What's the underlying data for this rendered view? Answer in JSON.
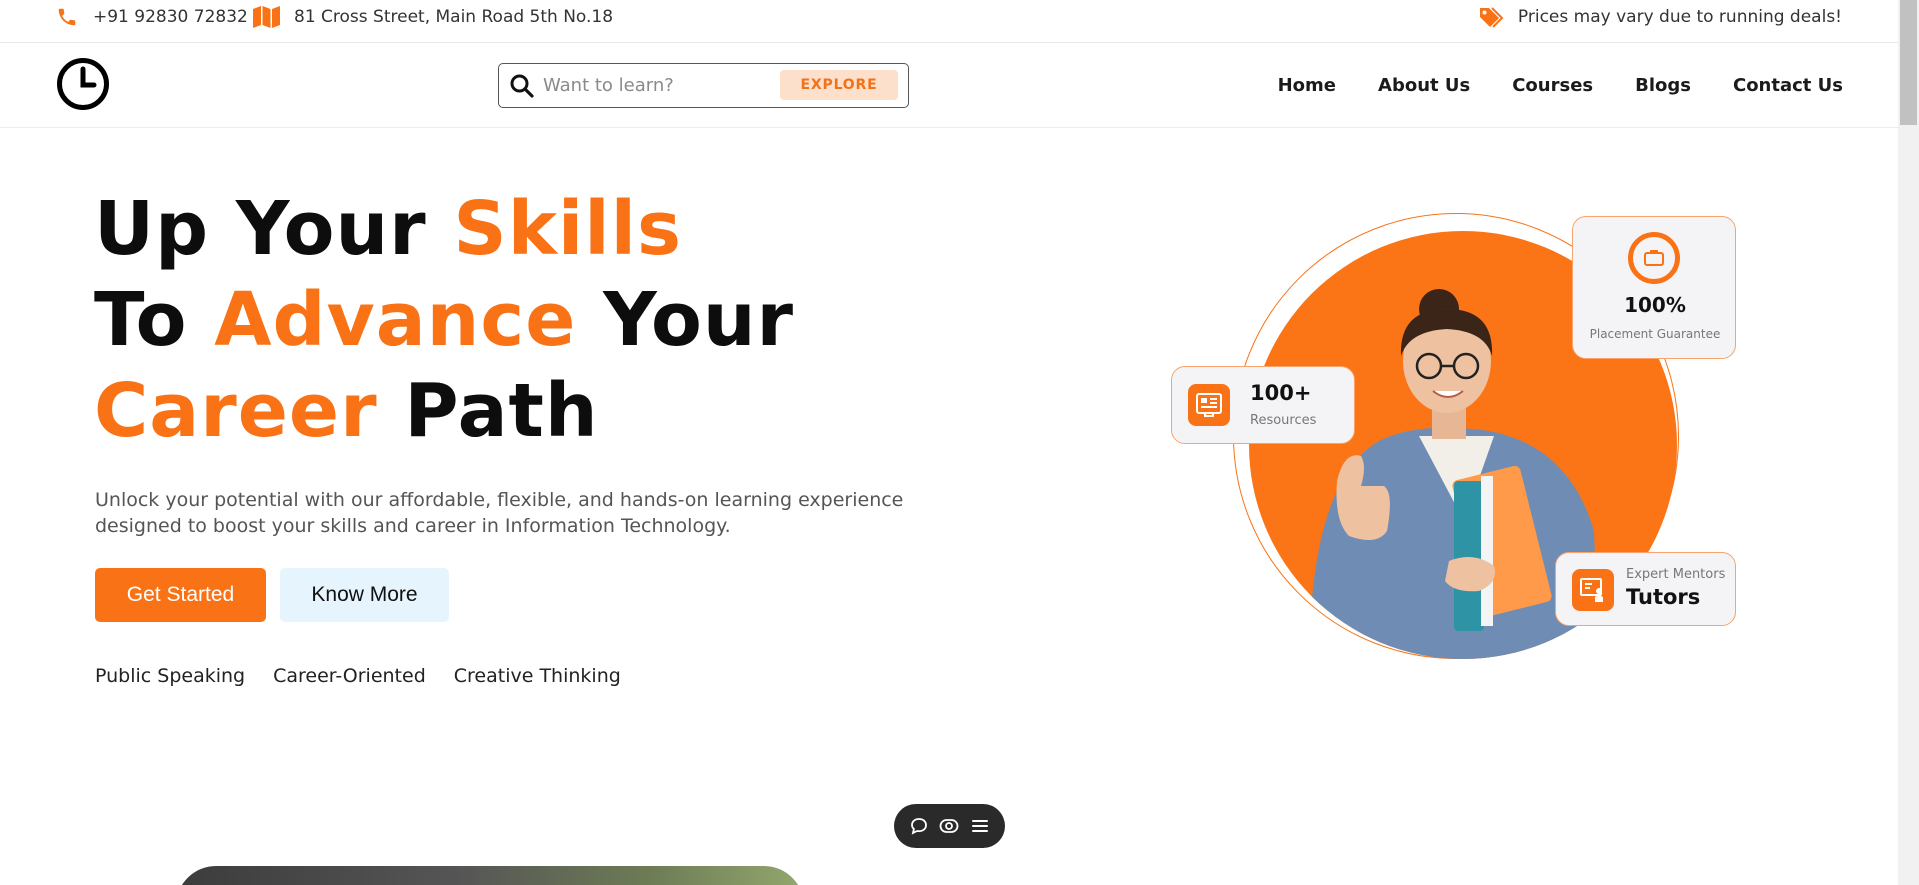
{
  "topbar": {
    "phone": "+91 92830 72832",
    "address": "81 Cross Street, Main Road 5th No.18",
    "deals": "Prices may vary due to running deals!"
  },
  "header": {
    "search_placeholder": "Want to learn?",
    "explore_label": "EXPLORE",
    "nav": [
      "Home",
      "About Us",
      "Courses",
      "Blogs",
      "Contact Us"
    ]
  },
  "hero": {
    "title": {
      "w1": "Up Your ",
      "w2": "Skills",
      "w3": "To ",
      "w4": "Advance",
      "w5": " Your",
      "w6": "Career",
      "w7": " Path"
    },
    "subtitle": "Unlock your potential with our affordable, flexible, and hands-on learning experience designed to boost your skills and career in Information Technology.",
    "primary_button": "Get Started",
    "secondary_button": "Know More",
    "tags": [
      "Public Speaking",
      "Career-Oriented",
      "Creative Thinking"
    ]
  },
  "stats": {
    "placement": {
      "value": "100%",
      "label": "Placement Guarantee"
    },
    "resources": {
      "value": "100+",
      "label": "Resources"
    },
    "tutors": {
      "label": "Expert Mentors",
      "value": "Tutors"
    }
  },
  "colors": {
    "accent": "#f97316",
    "accent_light": "#fde0cc",
    "secondary_bg": "#e5f4fd"
  }
}
